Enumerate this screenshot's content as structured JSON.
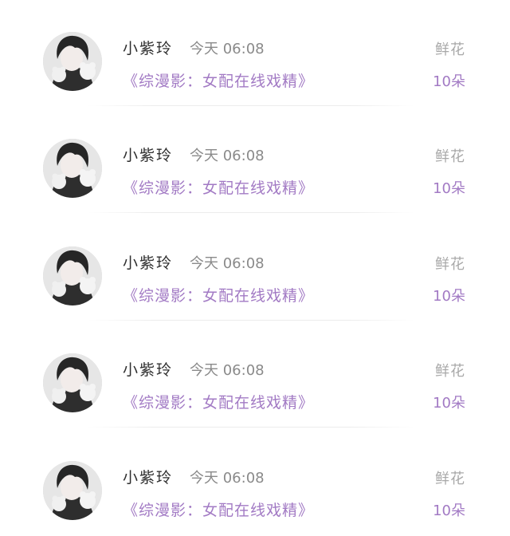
{
  "records": [
    {
      "user": "小紫玲",
      "time": "今天 06:08",
      "book": "《综漫影：女配在线戏精》",
      "gift_name": "鲜花",
      "gift_count": "10朵"
    },
    {
      "user": "小紫玲",
      "time": "今天 06:08",
      "book": "《综漫影：女配在线戏精》",
      "gift_name": "鲜花",
      "gift_count": "10朵"
    },
    {
      "user": "小紫玲",
      "time": "今天 06:08",
      "book": "《综漫影：女配在线戏精》",
      "gift_name": "鲜花",
      "gift_count": "10朵"
    },
    {
      "user": "小紫玲",
      "time": "今天 06:08",
      "book": "《综漫影：女配在线戏精》",
      "gift_name": "鲜花",
      "gift_count": "10朵"
    },
    {
      "user": "小紫玲",
      "time": "今天 06:08",
      "book": "《综漫影：女配在线戏精》",
      "gift_name": "鲜花",
      "gift_count": "10朵"
    }
  ],
  "colors": {
    "accent": "#a27ac4",
    "name": "#2f2f2f",
    "muted": "#8a8a8a",
    "gift_label": "#a8a8a8"
  }
}
